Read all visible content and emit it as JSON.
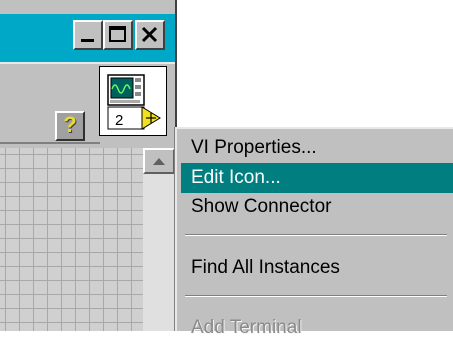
{
  "window": {
    "controls": {
      "minimize_icon": "minimize-icon",
      "maximize_icon": "maximize-icon",
      "close_icon": "close-icon"
    },
    "toolbar": {
      "help_label": "?",
      "help_icon": "help-question-icon"
    },
    "vi_icon": {
      "connector_count": "2",
      "icon": "waveform-vi-icon"
    }
  },
  "context_menu": {
    "items": [
      {
        "label": "VI Properties..."
      },
      {
        "label": "Edit Icon..."
      },
      {
        "label": "Show Connector"
      },
      {
        "label": "Find All Instances"
      },
      {
        "label": "Add Terminal"
      }
    ]
  },
  "colors": {
    "title_bar": "#00a8c8",
    "menu_highlight": "#007e80",
    "face": "#c0c0c0"
  }
}
